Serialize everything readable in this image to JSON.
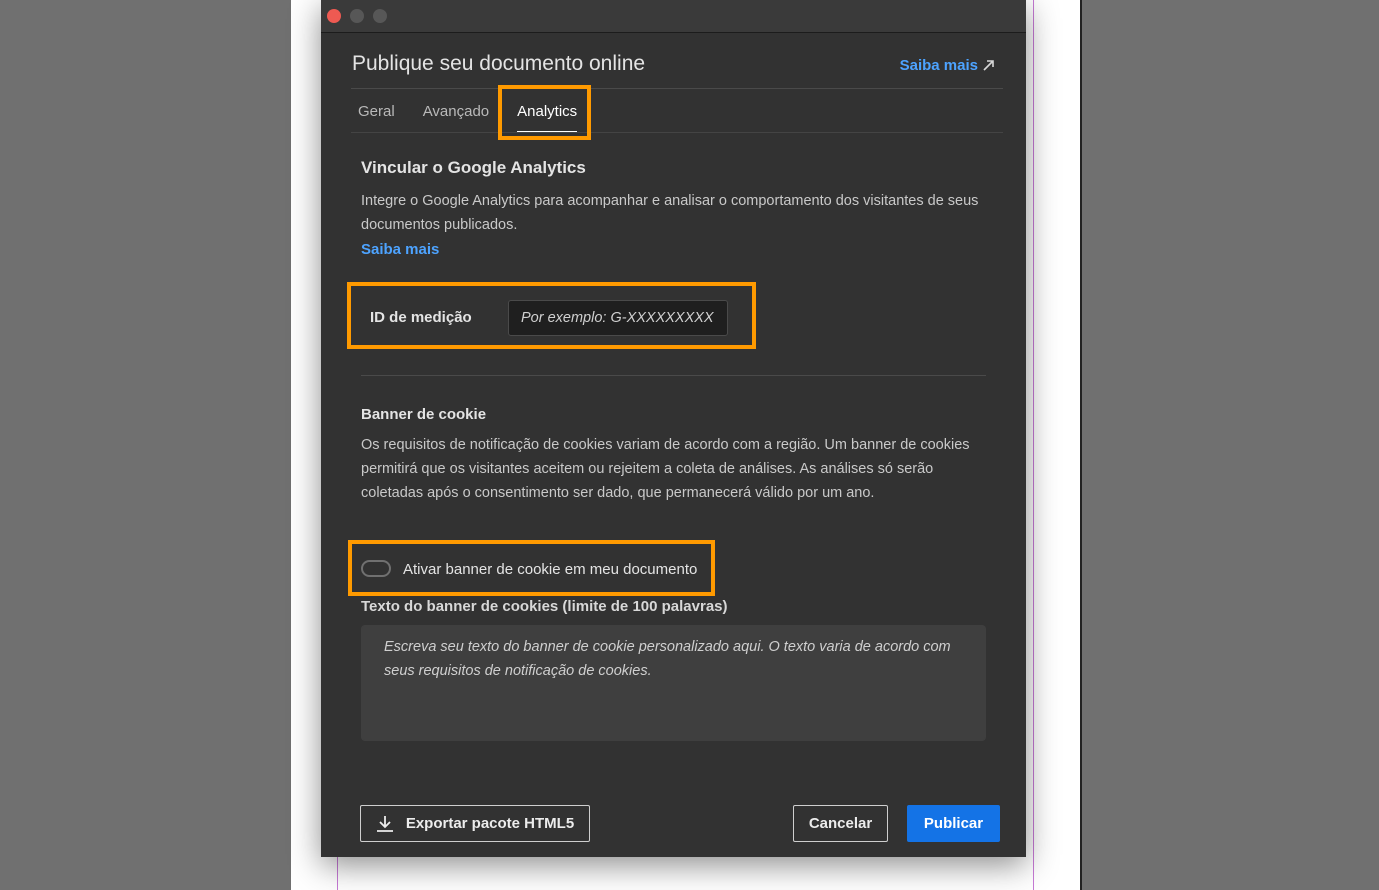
{
  "dialog": {
    "title": "Publique seu documento online",
    "help_link": "Saiba mais"
  },
  "tabs": [
    {
      "label": "Geral",
      "active": false
    },
    {
      "label": "Avançado",
      "active": false
    },
    {
      "label": "Analytics",
      "active": true
    }
  ],
  "analytics": {
    "title": "Vincular o Google Analytics",
    "description": "Integre o Google Analytics para acompanhar e analisar o comportamento dos visitantes de seus documentos publicados.",
    "learn_more": "Saiba mais",
    "measurement_id_label": "ID de medição",
    "measurement_id_placeholder": "Por exemplo: G-XXXXXXXXX",
    "measurement_id_value": ""
  },
  "cookie": {
    "title": "Banner de cookie",
    "description": "Os requisitos de notificação de cookies variam de acordo com a região. Um banner de cookies permitirá que os visitantes aceitem ou rejeitem a coleta de análises. As análises só serão coletadas após o consentimento ser dado, que permanecerá válido por um ano.",
    "toggle_label": "Ativar banner de cookie em meu documento",
    "toggle_on": false,
    "textarea_label": "Texto do banner de cookies (limite de 100 palavras)",
    "textarea_placeholder": "Escreva seu texto do banner de cookie personalizado aqui. O texto varia de acordo com seus requisitos de notificação de cookies."
  },
  "footer": {
    "export_label": "Exportar pacote HTML5",
    "cancel_label": "Cancelar",
    "publish_label": "Publicar"
  },
  "colors": {
    "dialog_bg": "#323232",
    "accent_blue": "#1473e6",
    "link_blue": "#4da3ff",
    "highlight_orange": "#ff9a00"
  },
  "icons": {
    "help_link": "external-arrow-icon",
    "export": "download-icon"
  }
}
